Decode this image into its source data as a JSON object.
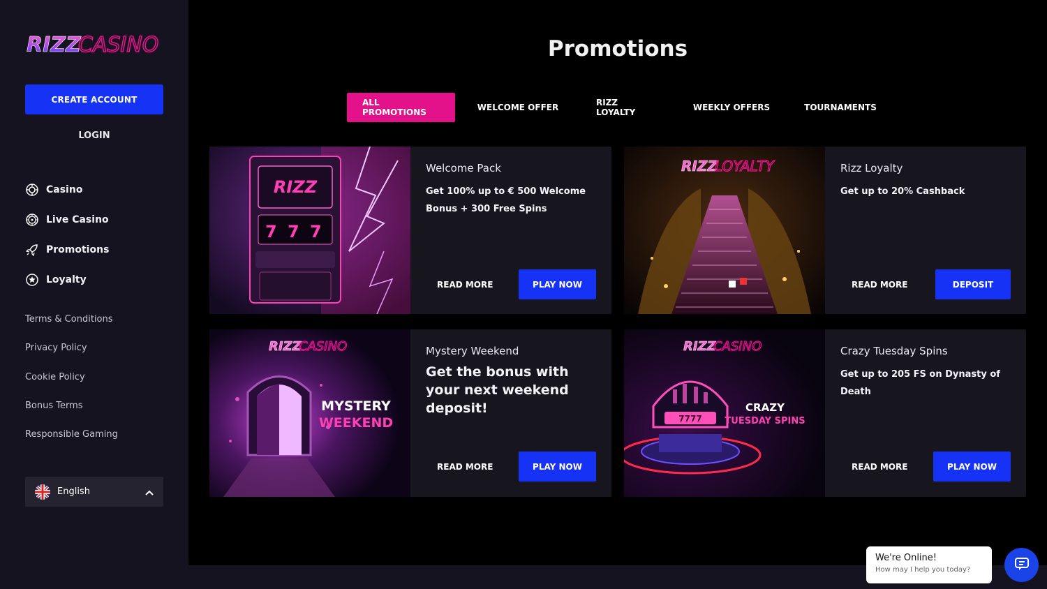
{
  "brand": {
    "logo_text_a": "RIZZ",
    "logo_text_b": "CASINO"
  },
  "sidebar": {
    "create_account": "CREATE ACCOUNT",
    "login": "LOGIN",
    "nav": [
      {
        "label": "Casino",
        "icon": "chip-icon"
      },
      {
        "label": "Live Casino",
        "icon": "roulette-icon"
      },
      {
        "label": "Promotions",
        "icon": "rocket-icon"
      },
      {
        "label": "Loyalty",
        "icon": "star-icon"
      }
    ],
    "links": [
      "Terms & Conditions",
      "Privacy Policy",
      "Cookie Policy",
      "Bonus Terms",
      "Responsible Gaming"
    ],
    "language": "English"
  },
  "main": {
    "title": "Promotions",
    "tabs": [
      "ALL PROMOTIONS",
      "WELCOME OFFER",
      "RIZZ LOYALTY",
      "WEEKLY OFFERS",
      "TOURNAMENTS"
    ],
    "cards": [
      {
        "title": "Welcome Pack",
        "desc": "Get 100% up to € 500 Welcome Bonus + 300 Free Spins",
        "read": "READ MORE",
        "action": "PLAY NOW",
        "img_text": "RIZZ"
      },
      {
        "title": "Rizz Loyalty",
        "desc": "Get up to 20% Cashback",
        "read": "READ MORE",
        "action": "DEPOSIT",
        "img_text_a": "RIZZ",
        "img_text_b": "LOYALTY"
      },
      {
        "title": "Mystery Weekend",
        "desc": "Get the bonus with your next weekend deposit!",
        "read": "READ MORE",
        "action": "PLAY NOW",
        "img_text_a": "RIZZ",
        "img_text_b": "CASINO",
        "img_label_1": "MYSTERY",
        "img_label_2": "WEEKEND"
      },
      {
        "title": "Crazy Tuesday Spins",
        "desc": "Get up to 205 FS on Dynasty of Death",
        "read": "READ MORE",
        "action": "PLAY NOW",
        "img_text_a": "RIZZ",
        "img_text_b": "CASINO",
        "img_label_1": "CRAZY",
        "img_label_2": "TUESDAY SPINS"
      }
    ]
  },
  "chat": {
    "status": "We're Online!",
    "prompt": "How may I help you today?"
  },
  "colors": {
    "accent_pink": "#e3128a",
    "accent_blue": "#1633f5",
    "sidebar_bg": "#14131f",
    "card_bg": "#17161f"
  }
}
